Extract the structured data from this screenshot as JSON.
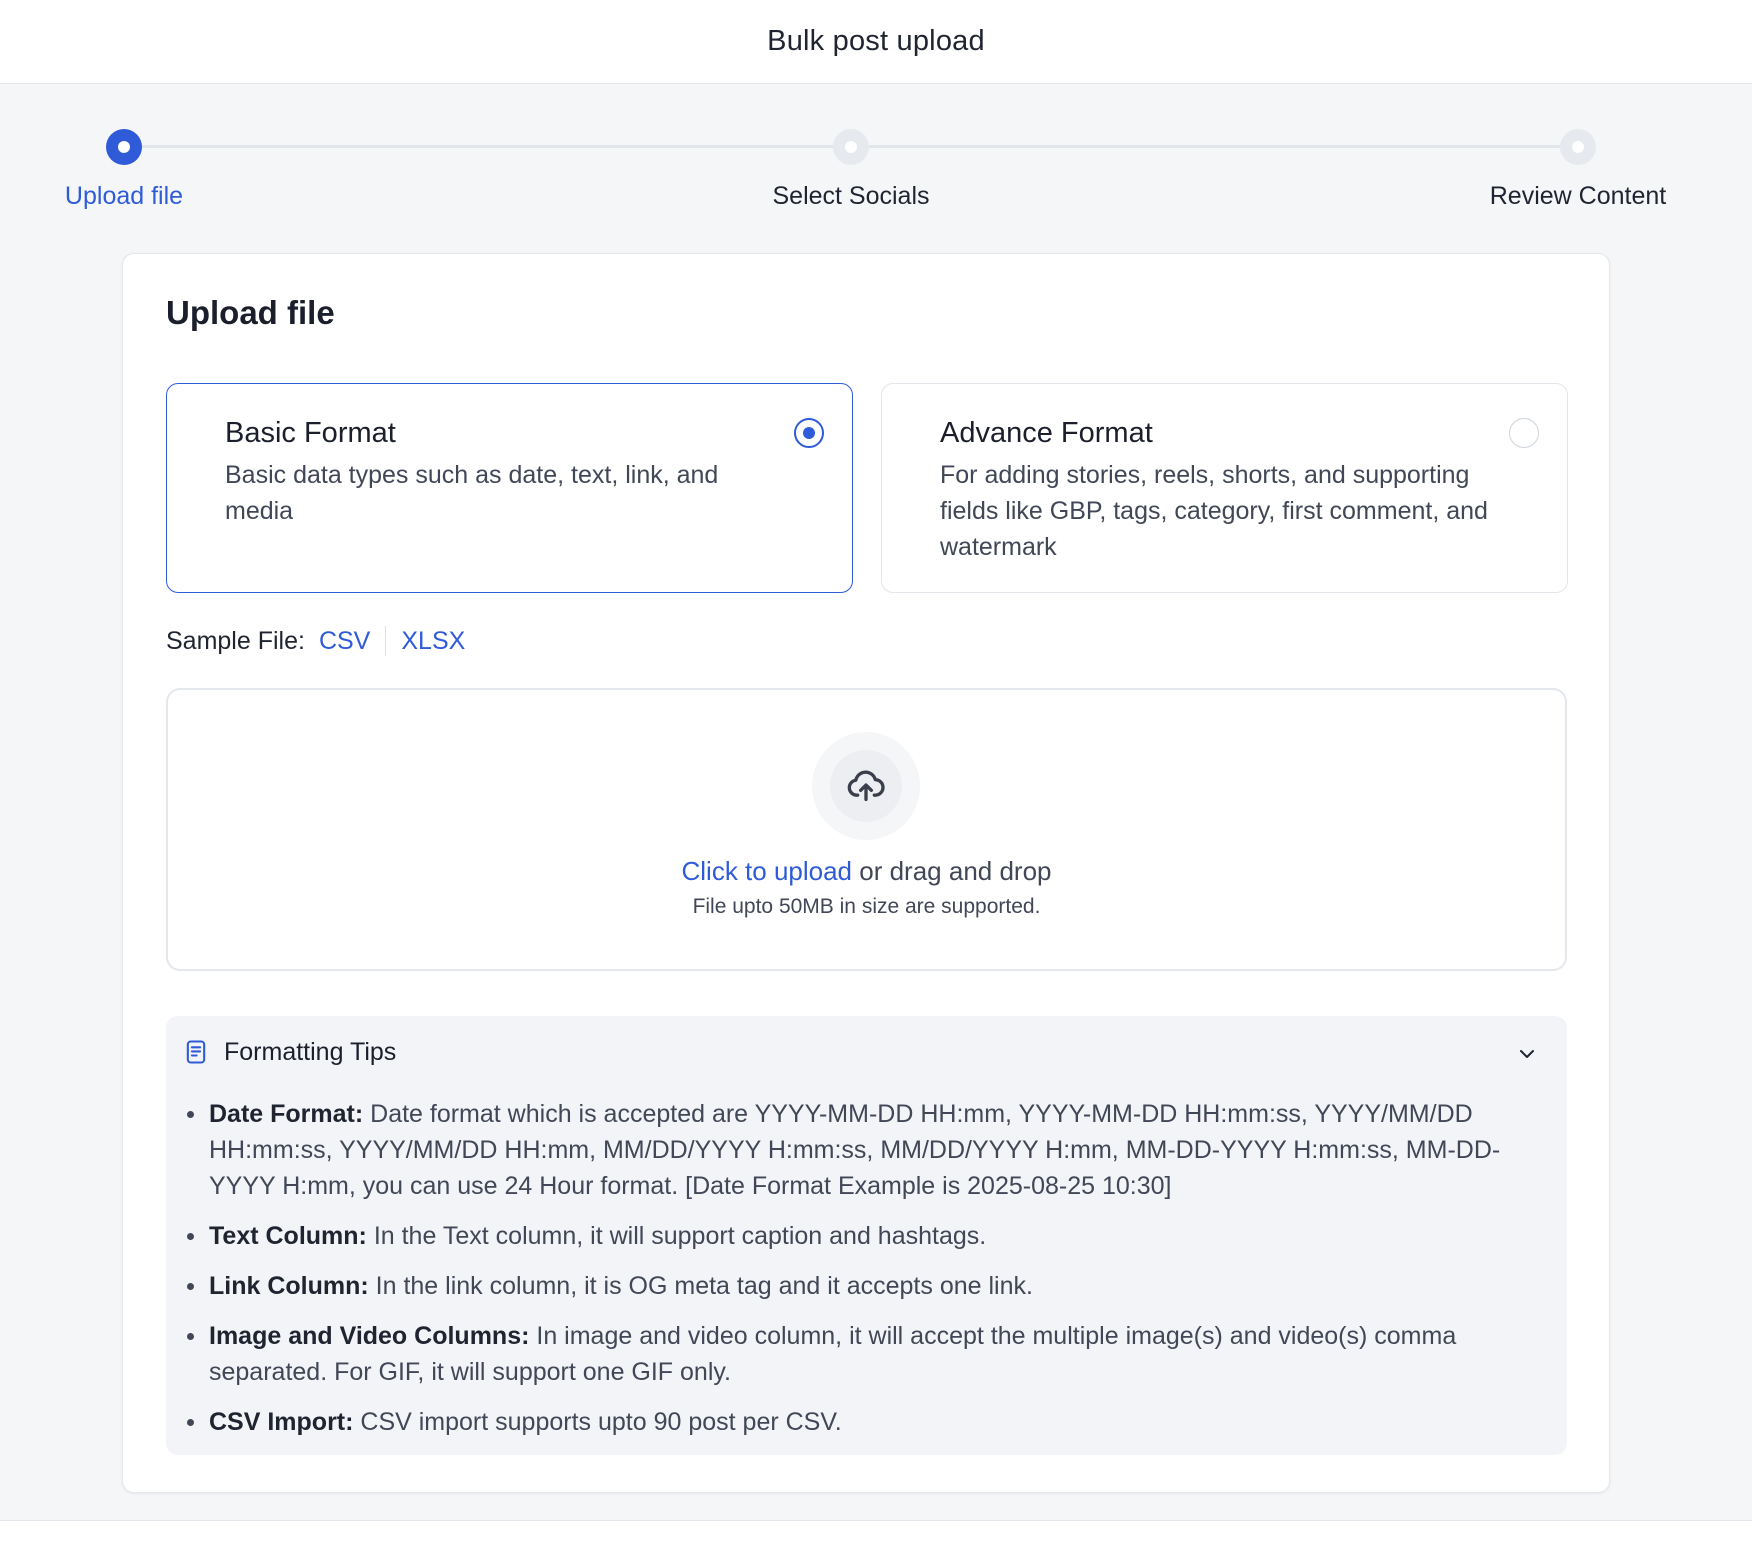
{
  "header": {
    "title": "Bulk post upload"
  },
  "stepper": {
    "steps": [
      {
        "label": "Upload file",
        "state": "active"
      },
      {
        "label": "Select Socials",
        "state": "pending"
      },
      {
        "label": "Review Content",
        "state": "pending"
      }
    ]
  },
  "card": {
    "title": "Upload file",
    "formats": [
      {
        "title": "Basic Format",
        "description": "Basic data types such as date, text, link, and media",
        "selected": true
      },
      {
        "title": "Advance Format",
        "description": "For adding stories, reels, shorts, and supporting fields like GBP, tags, category, first comment, and watermark",
        "selected": false
      }
    ],
    "sample": {
      "label": "Sample File:",
      "csv": "CSV",
      "xlsx": "XLSX"
    },
    "dropzone": {
      "link": "Click to upload",
      "text": " or drag and drop",
      "subtext": "File upto 50MB in size are supported.",
      "icon": "upload-cloud-icon"
    },
    "tips": {
      "title": "Formatting Tips",
      "items": [
        {
          "label": "Date Format:",
          "text": " Date format which is accepted are YYYY-MM-DD HH:mm, YYYY-MM-DD HH:mm:ss, YYYY/MM/DD HH:mm:ss, YYYY/MM/DD HH:mm, MM/DD/YYYY H:mm:ss, MM/DD/YYYY H:mm, MM-DD-YYYY H:mm:ss, MM-DD-YYYY H:mm, you can use 24 Hour format. [Date Format Example is 2025-08-25 10:30]"
        },
        {
          "label": "Text Column:",
          "text": " In the Text column, it will support caption and hashtags."
        },
        {
          "label": "Link Column:",
          "text": " In the link column, it is OG meta tag and it accepts one link."
        },
        {
          "label": "Image and Video Columns:",
          "text": " In image and video column, it will accept the multiple image(s) and video(s) comma separated. For GIF, it will support one GIF only."
        },
        {
          "label": "CSV Import:",
          "text": " CSV import supports upto 90 post per CSV."
        }
      ]
    }
  },
  "colors": {
    "accent": "#2f5bd8",
    "background": "#f5f6f8",
    "text": "#1f2430"
  }
}
